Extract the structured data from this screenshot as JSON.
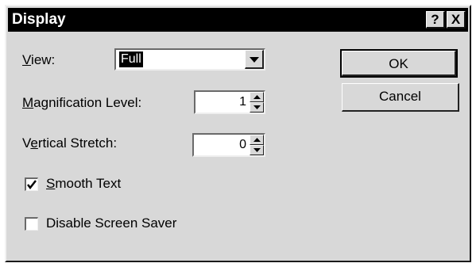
{
  "window": {
    "title": "Display",
    "help_label": "?",
    "close_label": "X"
  },
  "view": {
    "prefix": "",
    "accel": "V",
    "rest": "iew:",
    "selected": "Full"
  },
  "magnification": {
    "accel": "M",
    "rest": "agnification Level:",
    "value": "1"
  },
  "vertical_stretch": {
    "pre": "V",
    "accel": "e",
    "rest": "rtical Stretch:",
    "value": "0"
  },
  "smooth_text": {
    "accel": "S",
    "rest": "mooth Text",
    "checked": true
  },
  "screen_saver": {
    "label": "Disable Screen Saver",
    "checked": false
  },
  "buttons": {
    "ok": "OK",
    "cancel": "Cancel"
  }
}
